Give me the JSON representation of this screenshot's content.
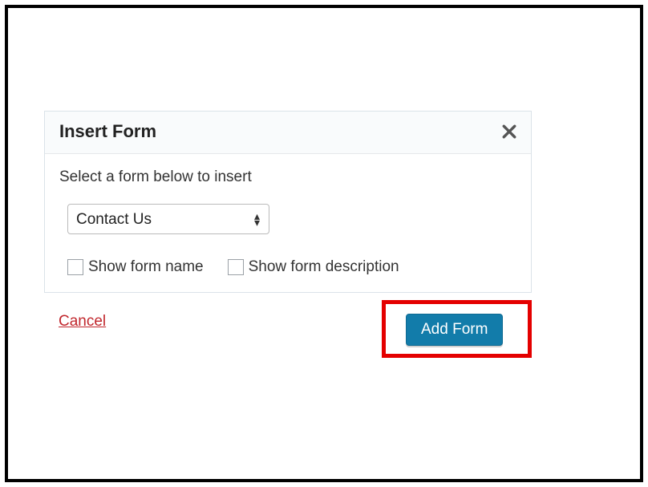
{
  "dialog": {
    "title": "Insert Form",
    "instruction": "Select a form below to insert",
    "select": {
      "value": "Contact Us",
      "options": [
        "Contact Us"
      ]
    },
    "checkboxes": {
      "show_name": {
        "label": "Show form name",
        "checked": false
      },
      "show_desc": {
        "label": "Show form description",
        "checked": false
      }
    }
  },
  "footer": {
    "cancel_label": "Cancel",
    "add_label": "Add Form"
  },
  "icons": {
    "close": "close-icon"
  }
}
